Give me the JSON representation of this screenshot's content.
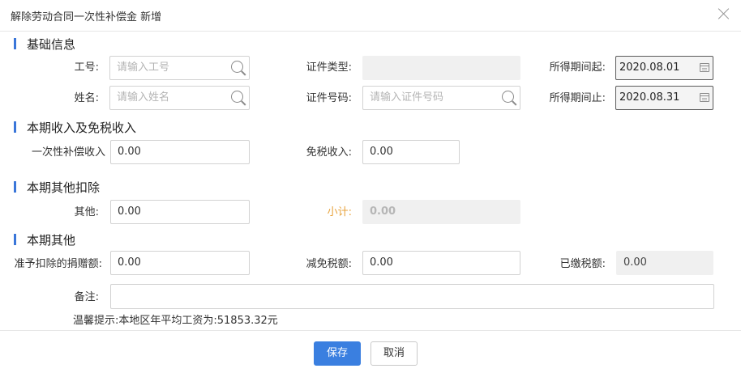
{
  "dialog": {
    "title": "解除劳动合同一次性补偿金 新增"
  },
  "sections": {
    "basic": "基础信息",
    "income": "本期收入及免税收入",
    "deduction": "本期其他扣除",
    "other": "本期其他"
  },
  "fields": {
    "emp_no": {
      "label": "工号:",
      "placeholder": "请输入工号"
    },
    "name": {
      "label": "姓名:",
      "placeholder": "请输入姓名"
    },
    "id_type": {
      "label": "证件类型:",
      "value": ""
    },
    "id_no": {
      "label": "证件号码:",
      "placeholder": "请输入证件号码"
    },
    "period_start": {
      "label": "所得期间起:",
      "value": "2020.08.01"
    },
    "period_end": {
      "label": "所得期间止:",
      "value": "2020.08.31"
    },
    "lump_sum": {
      "label": "一次性补偿收入",
      "value": "0.00"
    },
    "tax_free": {
      "label": "免税收入:",
      "value": "0.00"
    },
    "other_ded": {
      "label": "其他:",
      "value": "0.00"
    },
    "subtotal": {
      "label": "小计:",
      "value": "0.00"
    },
    "donation": {
      "label": "准予扣除的捐赠额:",
      "value": "0.00"
    },
    "tax_reduction": {
      "label": "减免税额:",
      "value": "0.00"
    },
    "tax_paid": {
      "label": "已缴税额:",
      "value": "0.00"
    },
    "remark": {
      "label": "备注:",
      "value": ""
    }
  },
  "tip": "温馨提示:本地区年平均工资为:51853.32元",
  "buttons": {
    "save": "保存",
    "cancel": "取消"
  }
}
